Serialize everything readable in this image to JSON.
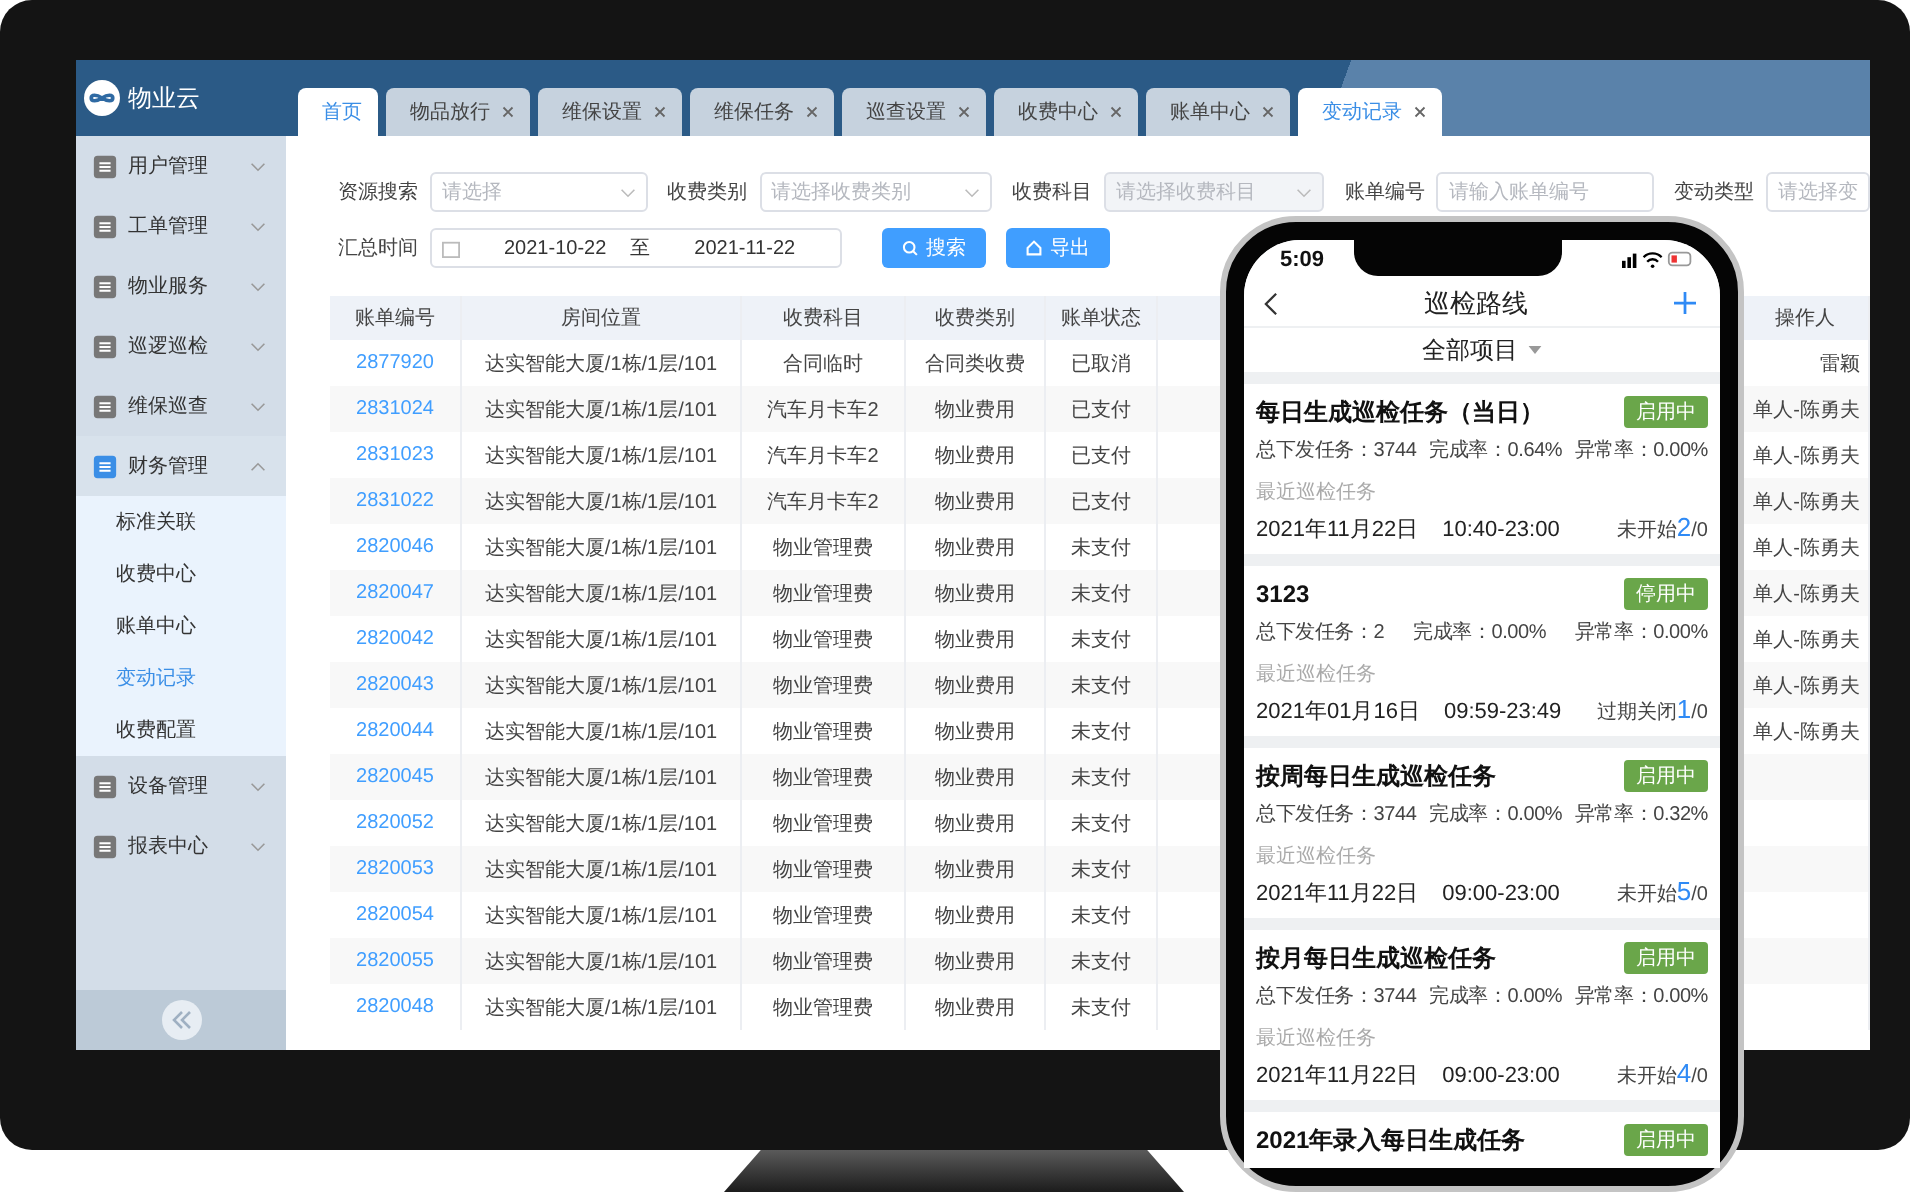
{
  "app": {
    "logo": "物业云"
  },
  "tabs": [
    {
      "label": "首页",
      "selected": true,
      "closable": false
    },
    {
      "label": "物品放行",
      "selected": false,
      "closable": true
    },
    {
      "label": "维保设置",
      "selected": false,
      "closable": true
    },
    {
      "label": "维保任务",
      "selected": false,
      "closable": true
    },
    {
      "label": "巡查设置",
      "selected": false,
      "closable": true
    },
    {
      "label": "收费中心",
      "selected": false,
      "closable": true
    },
    {
      "label": "账单中心",
      "selected": false,
      "closable": true
    },
    {
      "label": "变动记录",
      "selected": true,
      "closable": true
    }
  ],
  "sidebar": {
    "groups": [
      {
        "label": "用户管理",
        "expanded": false
      },
      {
        "label": "工单管理",
        "expanded": false
      },
      {
        "label": "物业服务",
        "expanded": false
      },
      {
        "label": "巡逻巡检",
        "expanded": false
      },
      {
        "label": "维保巡查",
        "expanded": false
      },
      {
        "label": "财务管理",
        "expanded": true,
        "children": [
          {
            "label": "标准关联",
            "selected": false
          },
          {
            "label": "收费中心",
            "selected": false
          },
          {
            "label": "账单中心",
            "selected": false
          },
          {
            "label": "变动记录",
            "selected": true
          },
          {
            "label": "收费配置",
            "selected": false
          }
        ]
      },
      {
        "label": "设备管理",
        "expanded": false
      },
      {
        "label": "报表中心",
        "expanded": false
      }
    ]
  },
  "filters": [
    {
      "label": "资源搜索",
      "kind": "select",
      "placeholder": "请选择",
      "disabled": false
    },
    {
      "label": "收费类别",
      "kind": "select",
      "placeholder": "请选择收费类别",
      "disabled": false
    },
    {
      "label": "收费科目",
      "kind": "select",
      "placeholder": "请选择收费科目",
      "disabled": true
    },
    {
      "label": "账单编号",
      "kind": "input",
      "placeholder": "请输入账单编号",
      "disabled": false
    },
    {
      "label": "变动类型",
      "kind": "select",
      "placeholder": "请选择变",
      "disabled": false
    }
  ],
  "date_filter": {
    "label": "汇总时间",
    "start": "2021-10-22",
    "separator": "至",
    "end": "2021-11-22"
  },
  "buttons": [
    {
      "label": "搜索",
      "kind": "search"
    },
    {
      "label": "导出",
      "kind": "export"
    }
  ],
  "table": {
    "columns": [
      "账单编号",
      "房间位置",
      "收费科目",
      "收费类别",
      "账单状态",
      "操作人"
    ],
    "rows": [
      [
        "2877920",
        "达实智能大厦/1栋/1层/101",
        "合同临时",
        "合同类收费",
        "已取消",
        "雷颖"
      ],
      [
        "2831024",
        "达实智能大厦/1栋/1层/101",
        "汽车月卡车2",
        "物业费用",
        "已支付",
        "单人-陈勇夫"
      ],
      [
        "2831023",
        "达实智能大厦/1栋/1层/101",
        "汽车月卡车2",
        "物业费用",
        "已支付",
        "单人-陈勇夫"
      ],
      [
        "2831022",
        "达实智能大厦/1栋/1层/101",
        "汽车月卡车2",
        "物业费用",
        "已支付",
        "单人-陈勇夫"
      ],
      [
        "2820046",
        "达实智能大厦/1栋/1层/101",
        "物业管理费",
        "物业费用",
        "未支付",
        "单人-陈勇夫"
      ],
      [
        "2820047",
        "达实智能大厦/1栋/1层/101",
        "物业管理费",
        "物业费用",
        "未支付",
        "单人-陈勇夫"
      ],
      [
        "2820042",
        "达实智能大厦/1栋/1层/101",
        "物业管理费",
        "物业费用",
        "未支付",
        "单人-陈勇夫"
      ],
      [
        "2820043",
        "达实智能大厦/1栋/1层/101",
        "物业管理费",
        "物业费用",
        "未支付",
        "单人-陈勇夫"
      ],
      [
        "2820044",
        "达实智能大厦/1栋/1层/101",
        "物业管理费",
        "物业费用",
        "未支付",
        "单人-陈勇夫"
      ],
      [
        "2820045",
        "达实智能大厦/1栋/1层/101",
        "物业管理费",
        "物业费用",
        "未支付"
      ],
      [
        "2820052",
        "达实智能大厦/1栋/1层/101",
        "物业管理费",
        "物业费用",
        "未支付"
      ],
      [
        "2820053",
        "达实智能大厦/1栋/1层/101",
        "物业管理费",
        "物业费用",
        "未支付"
      ],
      [
        "2820054",
        "达实智能大厦/1栋/1层/101",
        "物业管理费",
        "物业费用",
        "未支付"
      ],
      [
        "2820055",
        "达实智能大厦/1栋/1层/101",
        "物业管理费",
        "物业费用",
        "未支付"
      ],
      [
        "2820048",
        "达实智能大厦/1栋/1层/101",
        "物业管理费",
        "物业费用",
        "未支付"
      ]
    ]
  },
  "phone": {
    "time": "5:09",
    "title": "巡检路线",
    "filter": "全部项目",
    "cards": [
      {
        "title": "每日生成巡检任务（当日）",
        "badge": "启用中",
        "stats": [
          "总下发任务：3744",
          "完成率：0.64%",
          "异常率：0.00%"
        ],
        "recent_label": "最近巡检任务",
        "date": "2021年11月22日",
        "time": "10:40-23:00",
        "state": "未开始",
        "count": "2",
        "total": "/0"
      },
      {
        "title": "3123",
        "badge": "停用中",
        "stats": [
          "总下发任务：2",
          "完成率：0.00%",
          "异常率：0.00%"
        ],
        "recent_label": "最近巡检任务",
        "date": "2021年01月16日",
        "time": "09:59-23:49",
        "state": "过期关闭",
        "count": "1",
        "total": "/0"
      },
      {
        "title": "按周每日生成巡检任务",
        "badge": "启用中",
        "stats": [
          "总下发任务：3744",
          "完成率：0.00%",
          "异常率：0.32%"
        ],
        "recent_label": "最近巡检任务",
        "date": "2021年11月22日",
        "time": "09:00-23:00",
        "state": "未开始",
        "count": "5",
        "total": "/0"
      },
      {
        "title": "按月每日生成巡检任务",
        "badge": "启用中",
        "stats": [
          "总下发任务：3744",
          "完成率：0.00%",
          "异常率：0.00%"
        ],
        "recent_label": "最近巡检任务",
        "date": "2021年11月22日",
        "time": "09:00-23:00",
        "state": "未开始",
        "count": "4",
        "total": "/0"
      },
      {
        "title": "2021年录入每日生成任务",
        "badge": "启用中"
      }
    ]
  }
}
